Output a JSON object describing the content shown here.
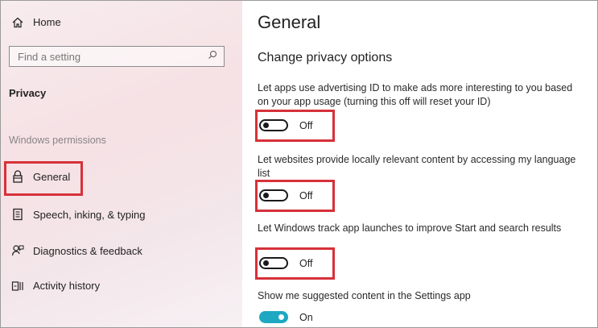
{
  "sidebar": {
    "home_label": "Home",
    "search_placeholder": "Find a setting",
    "section_title": "Privacy",
    "group_label": "Windows permissions",
    "items": [
      {
        "label": "General",
        "icon": "lock-icon"
      },
      {
        "label": "Speech, inking, & typing",
        "icon": "speech-inking-icon"
      },
      {
        "label": "Diagnostics & feedback",
        "icon": "diagnostics-feedback-icon"
      },
      {
        "label": "Activity history",
        "icon": "activity-history-icon"
      }
    ]
  },
  "main": {
    "title": "General",
    "subtitle": "Change privacy options",
    "options": [
      {
        "text": "Let apps use advertising ID to make ads more interesting to you based on your app usage (turning this off will reset your ID)",
        "state": "Off"
      },
      {
        "text": "Let websites provide locally relevant content by accessing my language list",
        "state": "Off"
      },
      {
        "text": "Let Windows track app launches to improve Start and search results",
        "state": "Off"
      },
      {
        "text": "Show me suggested content in the Settings app",
        "state": "On"
      }
    ]
  },
  "colors": {
    "highlight": "#d6313a",
    "toggle_on": "#1ea8c2",
    "sidebar_bg": "#f6e1e4"
  }
}
